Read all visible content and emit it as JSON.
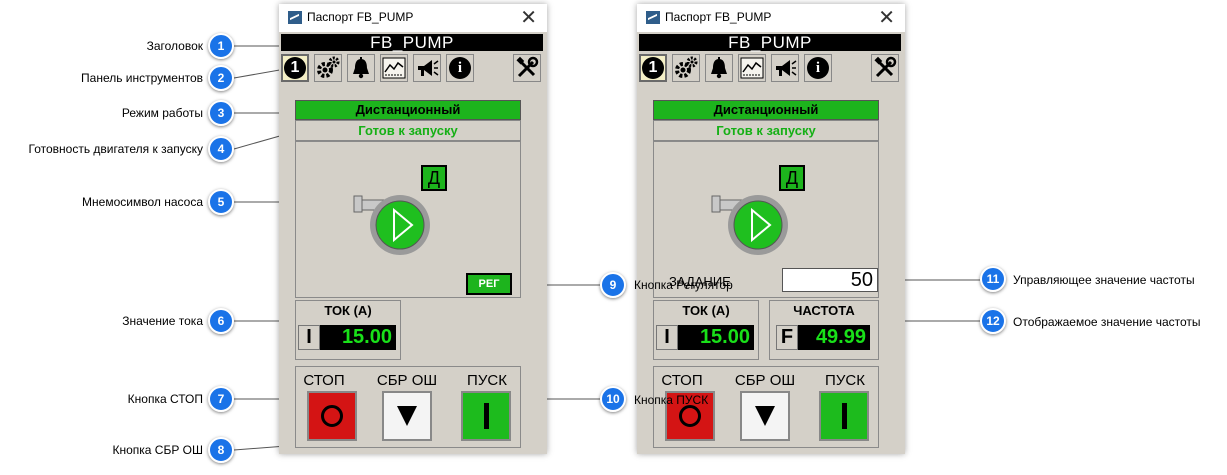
{
  "window_left": {
    "title": "Паспорт FB_PUMP",
    "close_glyph": "✕",
    "header": "FB_PUMP",
    "toolbar": [
      "number-1-icon",
      "gears-icon",
      "bell-icon",
      "trend-chart-icon",
      "megaphone-icon",
      "info-icon",
      "tools-icon"
    ],
    "toolbar_number": "1",
    "toolbar_info": "i",
    "mode": "Дистанционный",
    "ready": "Готов к запуску",
    "mode_badge": "Д",
    "reg_button": "РЕГ",
    "current_group_title": "ТОК (А)",
    "current_letter": "I",
    "current_value": "15.00",
    "stop_label": "СТОП",
    "reset_label": "СБР ОШ",
    "start_label": "ПУСК"
  },
  "window_right": {
    "title": "Паспорт FB_PUMP",
    "close_glyph": "✕",
    "header": "FB_PUMP",
    "toolbar_number": "1",
    "toolbar_info": "i",
    "mode": "Дистанционный",
    "ready": "Готов к запуску",
    "mode_badge": "Д",
    "setpoint_label": "ЗАДАНИЕ",
    "setpoint_value": "50",
    "current_group_title": "ТОК (А)",
    "current_letter": "I",
    "current_value": "15.00",
    "freq_group_title": "ЧАСТОТА",
    "freq_letter": "F",
    "freq_value": "49.99",
    "stop_label": "СТОП",
    "reset_label": "СБР ОШ",
    "start_label": "ПУСК"
  },
  "callouts": [
    {
      "num": "1",
      "label": "Заголовок"
    },
    {
      "num": "2",
      "label": "Панель инструментов"
    },
    {
      "num": "3",
      "label": "Режим работы"
    },
    {
      "num": "4",
      "label": "Готовность двигателя к запуску"
    },
    {
      "num": "5",
      "label": "Мнемосимвол насоса"
    },
    {
      "num": "6",
      "label": "Значение тока"
    },
    {
      "num": "7",
      "label": "Кнопка СТОП"
    },
    {
      "num": "8",
      "label": "Кнопка СБР ОШ"
    },
    {
      "num": "9",
      "label": "Кнопка Регулятор"
    },
    {
      "num": "10",
      "label": "Кнопка ПУСК"
    },
    {
      "num": "11",
      "label": "Управляющее значение частоты"
    },
    {
      "num": "12",
      "label": "Отображаемое значение частоты"
    }
  ],
  "colors": {
    "panel_bg": "#d4d0c8",
    "status_green": "#1db41d",
    "ready_text": "#16b016",
    "stop_red": "#d41414",
    "display_green": "#19e019",
    "callout_blue": "#1a73e8"
  }
}
